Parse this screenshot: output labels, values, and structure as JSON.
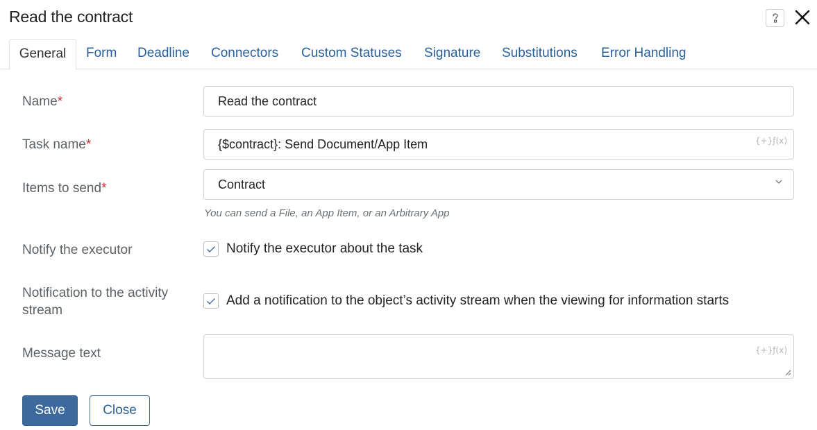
{
  "dialog": {
    "title": "Read the contract",
    "help_icon": "help-icon",
    "close_icon": "close-icon"
  },
  "tabs": [
    {
      "label": "General",
      "active": true
    },
    {
      "label": "Form"
    },
    {
      "label": "Deadline"
    },
    {
      "label": "Connectors"
    },
    {
      "label": "Custom Statuses"
    },
    {
      "label": "Signature"
    },
    {
      "label": "Substitutions"
    },
    {
      "label": "Error Handling"
    }
  ],
  "form": {
    "required_mark": "*",
    "name": {
      "label": "Name",
      "value": "Read the contract"
    },
    "task_name": {
      "label": "Task name",
      "value": "{$contract}: Send Document/App Item",
      "fx": "{+}ƒ(x)"
    },
    "items_to_send": {
      "label": "Items to send",
      "value": "Contract",
      "hint": "You can send a File, an App Item, or an Arbitrary App"
    },
    "notify_executor": {
      "label": "Notify the executor",
      "checkbox_text": "Notify the executor about the task",
      "checked": true
    },
    "notification_stream": {
      "label_line1": "Notification to the activity",
      "label_line2": "stream",
      "checkbox_text": "Add a notification to the object’s activity stream when the viewing for information starts",
      "checked": true
    },
    "message_text": {
      "label": "Message text",
      "value": "",
      "fx": "{+}ƒ(x)"
    }
  },
  "buttons": {
    "save": "Save",
    "close": "Close"
  },
  "colors": {
    "link_blue": "#2a5f99",
    "primary": "#3c6a9c",
    "required_red": "#d0312d"
  }
}
